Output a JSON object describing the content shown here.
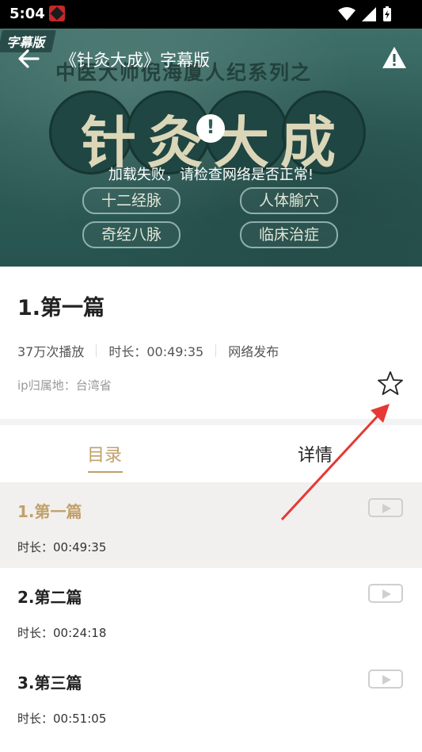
{
  "status_bar": {
    "time": "5:04"
  },
  "player": {
    "title": "《针灸大成》字幕版",
    "corner_tag": "字幕版",
    "series_line": "中医大师倪海厦人纪系列之",
    "big_title": "针灸大成",
    "error_message": "加载失败，请检查网络是否正常!",
    "topics": [
      "十二经脉",
      "人体腧穴",
      "奇经八脉",
      "临床治症"
    ]
  },
  "episode": {
    "title": "1.第一篇",
    "plays": "37万次播放",
    "duration": "时长：00:49:35",
    "source": "网络发布",
    "ip_location": "ip归属地：台湾省"
  },
  "tabs": [
    {
      "label": "目录",
      "active": true
    },
    {
      "label": "详情",
      "active": false
    }
  ],
  "episodes": [
    {
      "title": "1.第一篇",
      "duration": "时长：00:49:35",
      "active": true
    },
    {
      "title": "2.第二篇",
      "duration": "时长：00:24:18",
      "active": false
    },
    {
      "title": "3.第三篇",
      "duration": "时长：00:51:05",
      "active": false
    }
  ],
  "colors": {
    "accent": "#c2a06a",
    "banner": "#2f5e58",
    "annotation_arrow": "#e53935"
  },
  "icons": [
    "back-arrow-icon",
    "warning-icon",
    "error-icon",
    "star-icon",
    "play-icon",
    "wifi-icon",
    "signal-icon",
    "battery-icon"
  ]
}
